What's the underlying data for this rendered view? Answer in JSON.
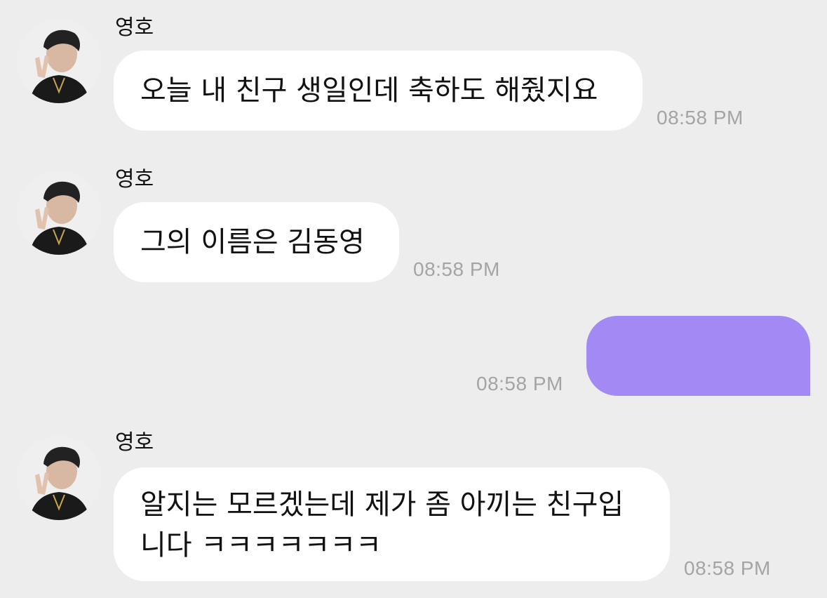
{
  "chat": {
    "messages": [
      {
        "sender": "영호",
        "text": "오늘 내 친구 생일인데 축하도 해줬지요",
        "time": "08:58 PM"
      },
      {
        "sender": "영호",
        "text": "그의 이름은 김동영",
        "time": "08:58 PM"
      },
      {
        "sender": "",
        "text": "",
        "time": "08:58 PM"
      },
      {
        "sender": "영호",
        "text": "알지는 모르겠는데 제가 좀 아끼는 친구입니다 ㅋㅋㅋㅋㅋㅋㅋ",
        "time": "08:58 PM"
      }
    ]
  },
  "colors": {
    "background": "#ededed",
    "incoming_bubble": "#ffffff",
    "outgoing_bubble": "#a389f4",
    "timestamp": "#a4a4a4"
  },
  "icons": {
    "avatar": "profile-photo"
  }
}
